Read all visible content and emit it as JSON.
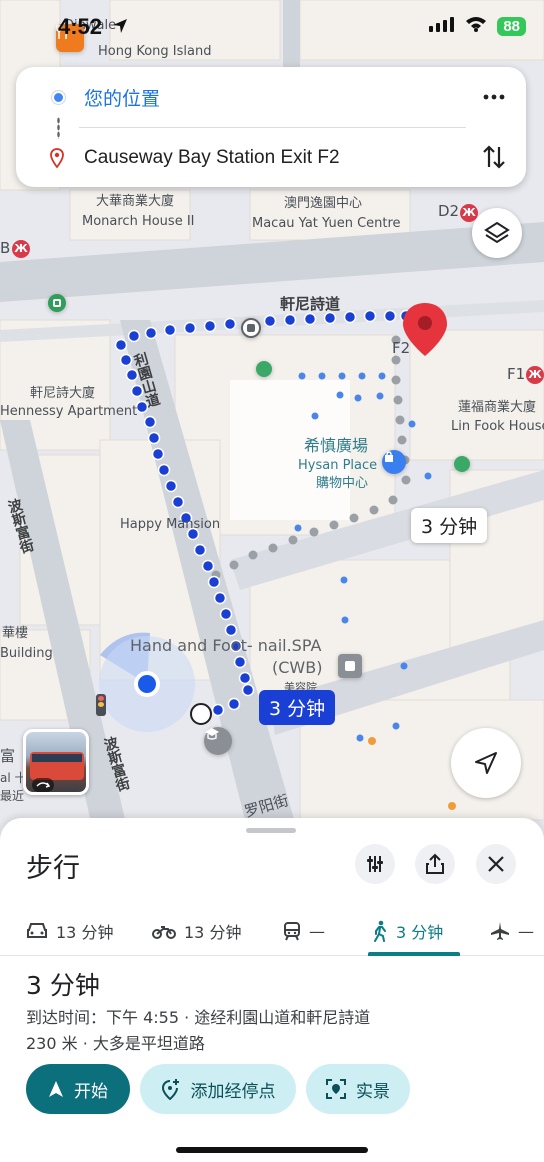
{
  "status_bar": {
    "time": "4:52",
    "battery": "88"
  },
  "map": {
    "labels": {
      "hk_top": "Dinwale",
      "hk_island": "Hong Kong Island",
      "monarch_zh": "大華商業大廈",
      "monarch_en": "Monarch House II",
      "macau_zh": "澳門逸園中心",
      "macau_en": "Macau Yat Yuen Centre",
      "d2": "D2",
      "b": "B",
      "hennessy_rd": "軒尼詩道",
      "lee_garden_rd": "利園山道",
      "hennessy_apt_zh": "軒尼詩大廈",
      "hennessy_apt_en": "Hennessy Apartment",
      "lin_fook_zh": "蓮福商業大廈",
      "lin_fook_en": "Lin Fook House",
      "f1": "F1",
      "f2": "F2",
      "hysan_zh": "希慎廣場",
      "hysan_en": "Hysan Place",
      "hysan_mall": "購物中心",
      "happy_mansion": "Happy Mansion",
      "percival_st": "波斯富街",
      "percival_st2": "波斯富街",
      "hua_lou": "華樓",
      "building": "Building",
      "nail_spa": "Hand and Foot- nail.SPA",
      "cwb": "(CWB)",
      "beauty": "美容院",
      "street_bottom": "罗阳街",
      "fu_partial": "富",
      "al_partial": "al 十",
      "recent": "最近",
      "mtr_glyph": "⓿"
    },
    "tags": {
      "dest_walk": "3 分钟",
      "route_walk": "3 分钟"
    }
  },
  "route": {
    "origin": "您的位置",
    "destination": "Causeway Bay Station Exit F2"
  },
  "sheet": {
    "title": "步行",
    "modes": [
      {
        "label": "13 分钟",
        "icon": "car-icon"
      },
      {
        "label": "13 分钟",
        "icon": "motorcycle-icon"
      },
      {
        "label": "—",
        "icon": "transit-icon"
      },
      {
        "label": "3 分钟",
        "icon": "walk-icon"
      },
      {
        "label": "—",
        "icon": "flight-icon"
      }
    ],
    "summary": {
      "time": "3 分钟",
      "arrival": "到达时间：下午 4:55 · 途经利園山道和軒尼詩道",
      "distance": "230 米 · 大多是平坦道路"
    },
    "buttons": {
      "start": "开始",
      "add_stop": "添加经停点",
      "live_view": "实景"
    }
  },
  "colors": {
    "accent": "#0b6f7c",
    "route_blue": "#1a3fd4",
    "pin_red": "#e5343d"
  }
}
